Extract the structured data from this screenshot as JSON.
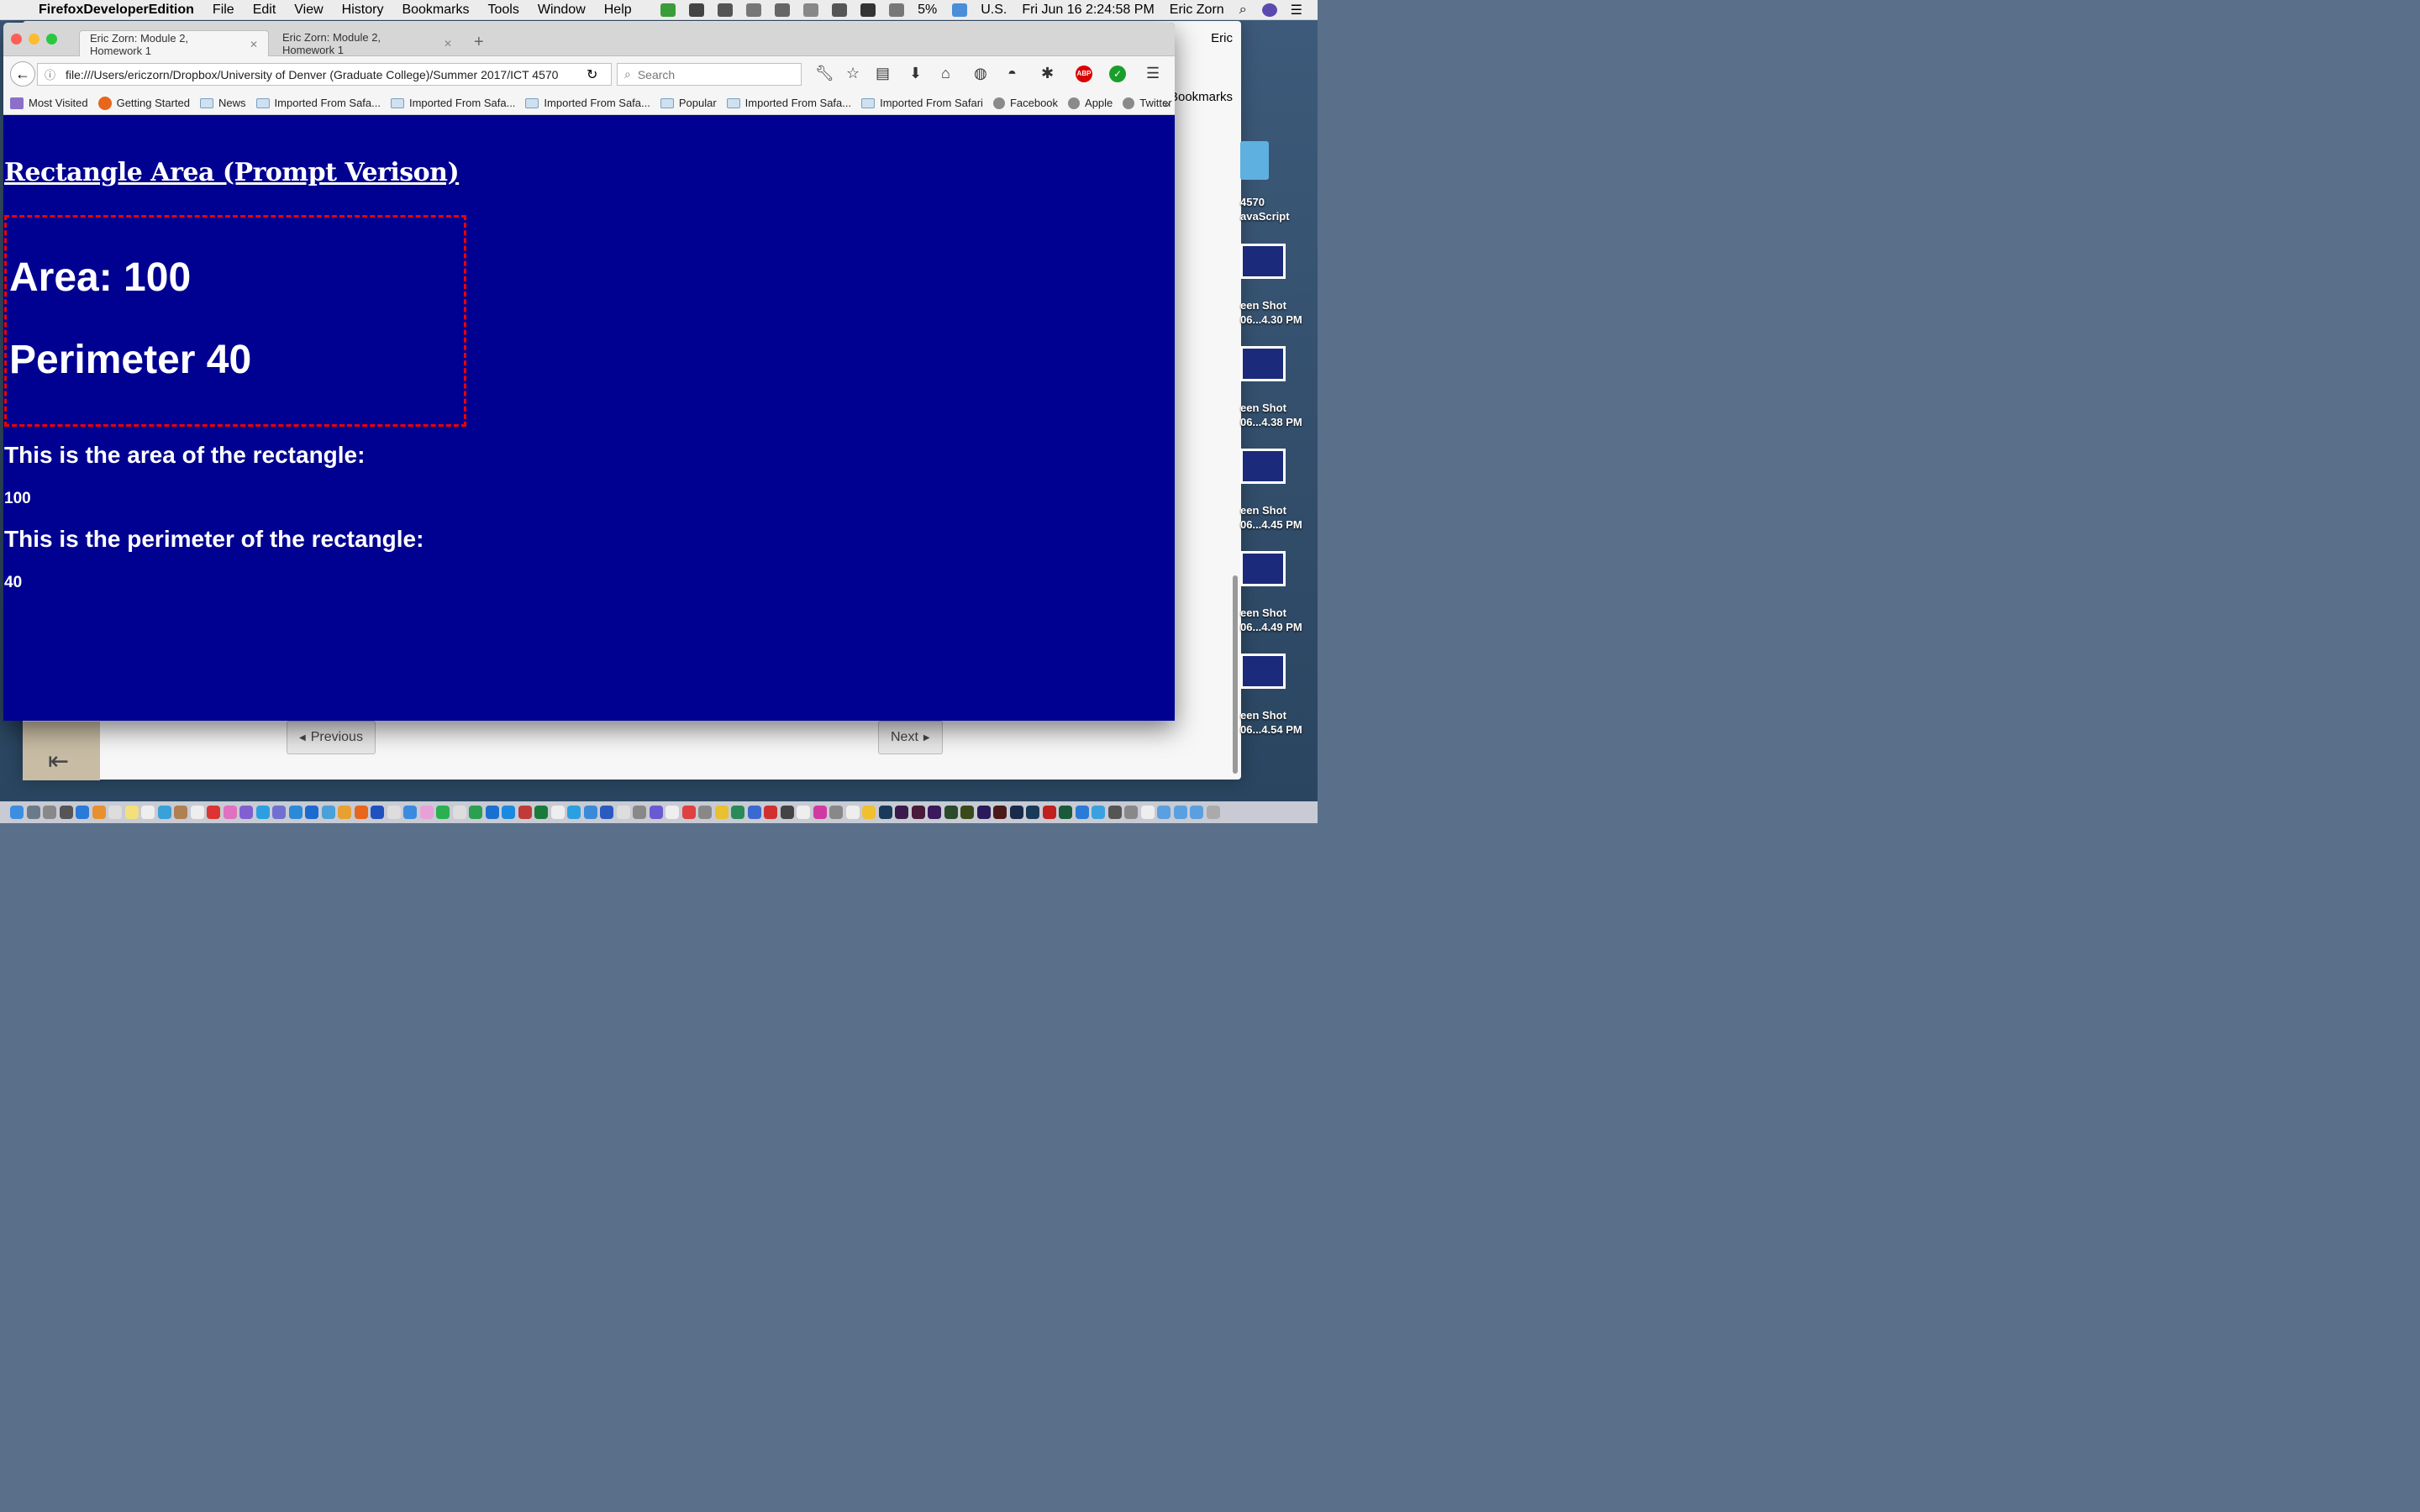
{
  "menubar": {
    "app": "FirefoxDeveloperEdition",
    "items": [
      "File",
      "Edit",
      "View",
      "History",
      "Bookmarks",
      "Tools",
      "Window",
      "Help"
    ],
    "battery": "5%",
    "input": "U.S.",
    "clock": "Fri Jun 16  2:24:58 PM",
    "user": "Eric Zorn"
  },
  "background_window": {
    "user": "Eric",
    "bookmarks_label": "Bookmarks",
    "previous_label": "Previous",
    "next_label": "Next"
  },
  "desktop": {
    "folder_label_1": "4570",
    "folder_label_2": "avaScript",
    "screenshots": [
      {
        "line1": "een Shot",
        "line2": "06...4.30 PM"
      },
      {
        "line1": "een Shot",
        "line2": "06...4.38 PM"
      },
      {
        "line1": "een Shot",
        "line2": "06...4.45 PM"
      },
      {
        "line1": "een Shot",
        "line2": "06...4.49 PM"
      },
      {
        "line1": "een Shot",
        "line2": "06...4.54 PM"
      }
    ]
  },
  "browser": {
    "tabs": [
      "Eric Zorn: Module 2, Homework 1",
      "Eric Zorn: Module 2, Homework 1"
    ],
    "url": "file:///Users/ericzorn/Dropbox/University of Denver (Graduate College)/Summer 2017/ICT 4570",
    "search_placeholder": "Search",
    "bookmarks": [
      "Most Visited",
      "Getting Started",
      "News",
      "Imported From Safa...",
      "Imported From Safa...",
      "Imported From Safa...",
      "Popular",
      "Imported From Safa...",
      "Imported From Safari",
      "Facebook",
      "Apple",
      "Twitter"
    ]
  },
  "page": {
    "heading": "Rectangle Area (Prompt Verison)",
    "area_line": "Area: 100",
    "perimeter_line": "Perimeter 40",
    "area_heading": "This is the area of the rectangle:",
    "area_value": "100",
    "perimeter_heading": "This is the perimeter of the rectangle:",
    "perimeter_value": "40"
  },
  "colors": {
    "page_background": "#000091",
    "box_border": "#e00000",
    "text": "#ffffff"
  }
}
